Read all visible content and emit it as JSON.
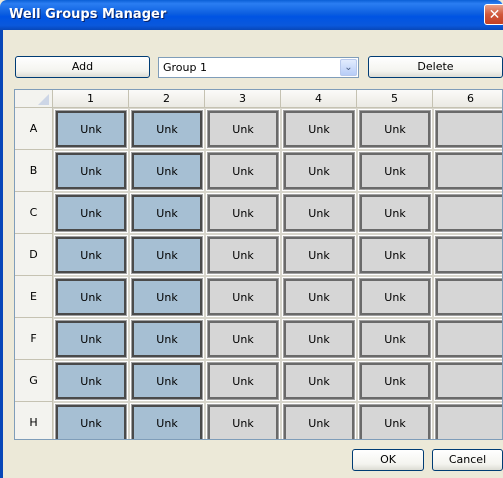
{
  "window": {
    "title": "Well Groups Manager",
    "close_glyph": "✕"
  },
  "toolbar": {
    "add_label": "Add",
    "group_select": {
      "value": "Group 1",
      "arrow": "⌄"
    },
    "delete_label": "Delete"
  },
  "grid": {
    "columns": [
      "1",
      "2",
      "3",
      "4",
      "5",
      "6"
    ],
    "rows": [
      "A",
      "B",
      "C",
      "D",
      "E",
      "F",
      "G",
      "H"
    ],
    "cell_text": "Unk",
    "filled_columns": 5,
    "selected_columns": [
      1,
      2
    ]
  },
  "footer": {
    "ok_label": "OK",
    "cancel_label": "Cancel"
  },
  "colors": {
    "selected_well": "#a6bfd3",
    "unselected_well": "#d6d6d6",
    "title_bar": "#0054e3"
  }
}
